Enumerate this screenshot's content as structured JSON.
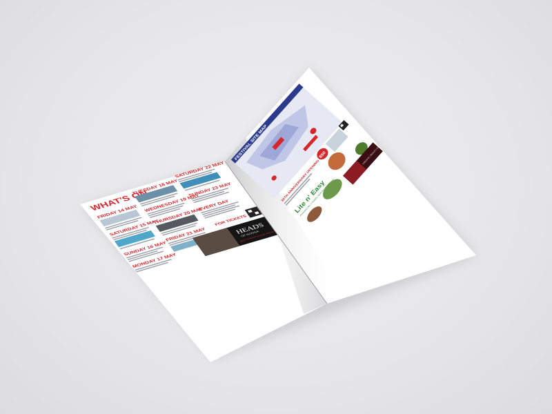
{
  "colors": {
    "background": "#e8e8ea",
    "accent_red": "#d7262b",
    "navy": "#1f2a6b",
    "green": "#2e8b3d",
    "dark": "#1b1b1b"
  },
  "left_page": {
    "heading": "WHAT'S ON",
    "col1": {
      "friday": "FRIDAY 14 MAY",
      "saturday": "SATURDAY 15 MAY",
      "sunday": "SUNDAY 16 MAY",
      "monday": "MONDAY 17 MAY"
    },
    "col2": {
      "tuesday": "TUESDAY 18 MAY",
      "wednesday": "WEDNESDAY 19 MAY",
      "thursday": "THURSDAY 20 MAY",
      "friday": "FRIDAY 21 MAY"
    },
    "col3": {
      "saturday": "SATURDAY 22 MAY",
      "sunday": "SUNDAY 23 MAY",
      "everyday": "EVERY DAY"
    },
    "tickets": "FOR TICKETS + UPDATES",
    "ad": {
      "brand": "HEADS",
      "tagline": "OF NOOSA",
      "small": "JUST EXCEPTIONAL FOOD"
    }
  },
  "right_page": {
    "map_title": "FESTIVAL SITE MAP",
    "party": "30TH ANNIVERSARY OPENING PARTY",
    "badge": "$50",
    "ad_lite": {
      "brand": "Lite n' Easy",
      "tagline": "Australia's No.1 Healthy Meal Delivery Service"
    },
    "ad_dark": {
      "text": "CREATE | BUILD | GROW"
    }
  }
}
